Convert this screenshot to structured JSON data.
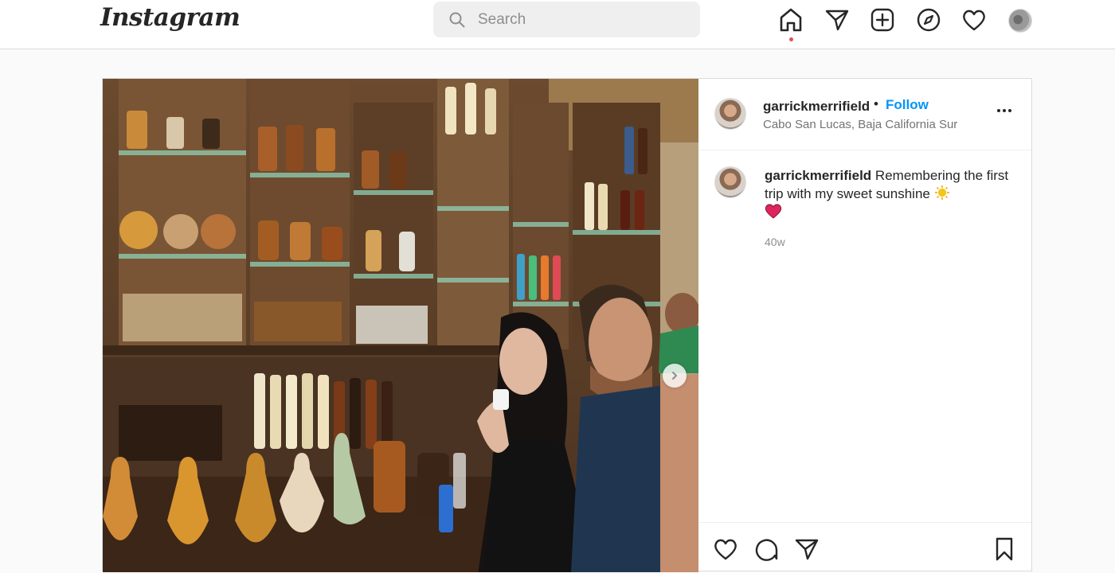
{
  "app": {
    "logo_text": "Instagram"
  },
  "search": {
    "placeholder": "Search",
    "value": ""
  },
  "nav": {
    "icons": [
      "home-icon",
      "direct-message-icon",
      "new-post-icon",
      "explore-icon",
      "activity-icon",
      "profile-avatar"
    ],
    "active": "home",
    "notification_dot_color": "#ed4956"
  },
  "post": {
    "username": "garrickmerrifield",
    "follow_label": "Follow",
    "separator": "•",
    "location": "Cabo San Lucas, Baja California Sur",
    "caption_username": "garrickmerrifield",
    "caption_text": "Remembering the first trip with my sweet sunshine",
    "caption_emojis": [
      "sun-emoji",
      "heart-emoji"
    ],
    "time_ago": "40w",
    "colors": {
      "follow": "#0095f6",
      "heart_emoji": "#e0245e",
      "sun_emoji": "#f5c518"
    }
  }
}
